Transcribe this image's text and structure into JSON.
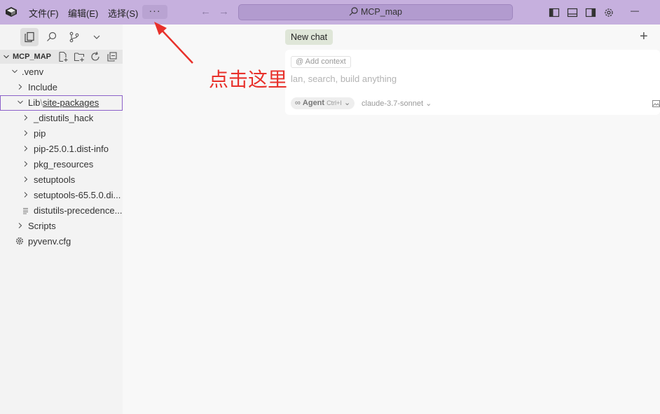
{
  "titlebar": {
    "menus": [
      "文件(F)",
      "编辑(E)",
      "选择(S)"
    ],
    "more_label": "···",
    "search_text": "MCP_map",
    "back_arrow": "←",
    "forward_arrow": "→",
    "minimize_glyph": "—"
  },
  "sidebar": {
    "explorer_title": "MCP_MAP",
    "tree": [
      {
        "label": ".venv",
        "kind": "folder",
        "expanded": true
      },
      {
        "label": "Include",
        "kind": "folder",
        "expanded": false
      },
      {
        "label": "Lib",
        "kind": "folder",
        "expanded": true,
        "sep": "\\",
        "sub_label": "site-packages"
      },
      {
        "label": "_distutils_hack",
        "kind": "folder",
        "expanded": false
      },
      {
        "label": "pip",
        "kind": "folder",
        "expanded": false
      },
      {
        "label": "pip-25.0.1.dist-info",
        "kind": "folder",
        "expanded": false
      },
      {
        "label": "pkg_resources",
        "kind": "folder",
        "expanded": false
      },
      {
        "label": "setuptools",
        "kind": "folder",
        "expanded": false
      },
      {
        "label": "setuptools-65.5.0.di...",
        "kind": "folder",
        "expanded": false
      },
      {
        "label": "distutils-precedence...",
        "kind": "file"
      },
      {
        "label": "Scripts",
        "kind": "folder",
        "expanded": false
      },
      {
        "label": "pyvenv.cfg",
        "kind": "settings-file"
      }
    ]
  },
  "chat": {
    "new_chat_label": "New chat",
    "plus_glyph": "+",
    "context_label": "@ Add context",
    "placeholder": "Plan, search, build anything",
    "visible_placeholder": "lan, search, build anything",
    "agent_label": "Agent",
    "agent_shortcut": "Ctrl+I",
    "model_label": "claude-3.7-sonnet"
  },
  "annotation": {
    "text": "点击这里",
    "color": "#e8312b"
  },
  "colors": {
    "titlebar": "#c6b0de",
    "accent_border": "#8c62c9"
  }
}
